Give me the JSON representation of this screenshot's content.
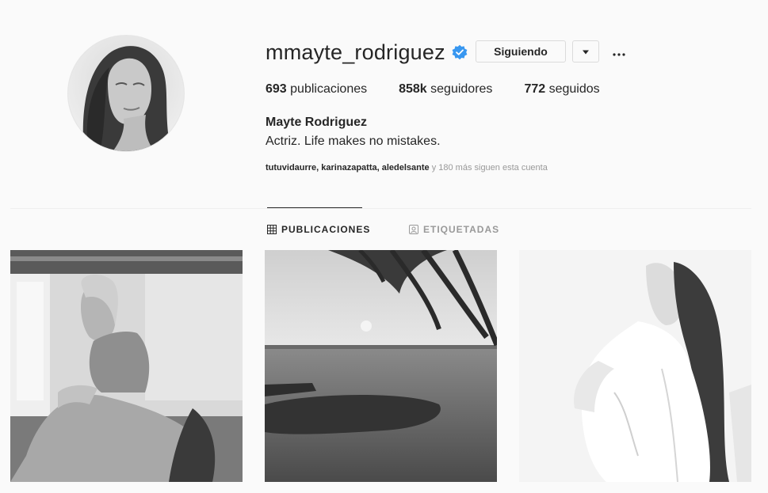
{
  "profile": {
    "username": "mmayte_rodriguez",
    "follow_label": "Siguiendo",
    "dropdown_glyph": "▾",
    "more_glyph": "···",
    "verified_color": "#3897f0"
  },
  "stats": {
    "posts_count": "693",
    "posts_label": "publicaciones",
    "followers_count": "858k",
    "followers_label": "seguidores",
    "following_count": "772",
    "following_label": "seguidos"
  },
  "bio": {
    "full_name": "Mayte Rodriguez",
    "text": "Actriz. Life makes no mistakes."
  },
  "followed_by": {
    "names": "tutuvidaurre, karinazapatta, aledelsante",
    "rest": " y 180 más siguen esta cuenta"
  },
  "tabs": [
    {
      "label": "PUBLICACIONES",
      "icon": "grid-icon",
      "active": true
    },
    {
      "label": "ETIQUETADAS",
      "icon": "tagged-icon",
      "active": false
    }
  ],
  "posts": [
    {
      "description_icon": "photo-woman-seated"
    },
    {
      "description_icon": "photo-sea-palm"
    },
    {
      "description_icon": "photo-woman-white-shirt"
    }
  ]
}
